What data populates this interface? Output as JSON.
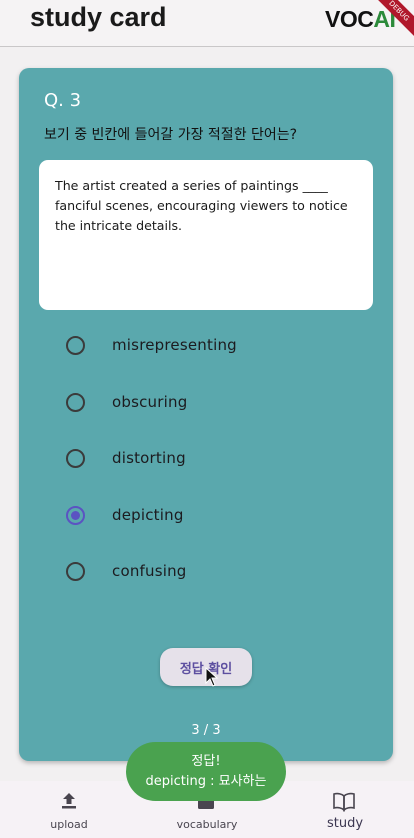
{
  "appbar": {
    "title": "study card",
    "logo_voc": "VOC",
    "logo_ai": "AI",
    "debug_banner": "DEBUG"
  },
  "question": {
    "number": "Q. 3",
    "prompt": "보기 중 빈칸에 들어갈 가장 적절한 단어는?",
    "sentence": "The artist created a series of paintings ____ fanciful scenes, encouraging viewers to notice the intricate details."
  },
  "options": [
    {
      "label": "misrepresenting",
      "selected": false
    },
    {
      "label": "obscuring",
      "selected": false
    },
    {
      "label": "distorting",
      "selected": false
    },
    {
      "label": "depicting",
      "selected": true
    },
    {
      "label": "confusing",
      "selected": false
    }
  ],
  "check_button": {
    "label": "정답 확인"
  },
  "progress": "3 / 3",
  "toast": {
    "line1": "정답!",
    "line2": "depicting : 묘사하는"
  },
  "bottom_nav": [
    {
      "label": "upload",
      "icon": "upload-icon",
      "active": false
    },
    {
      "label": "vocabulary",
      "icon": "folder-icon",
      "active": false
    },
    {
      "label": "study",
      "icon": "book-icon",
      "active": true
    }
  ],
  "colors": {
    "card": "#5aa8ad",
    "accent": "#5b53c2",
    "toast": "#4aa24f",
    "logo_green": "#2c8a3a"
  }
}
